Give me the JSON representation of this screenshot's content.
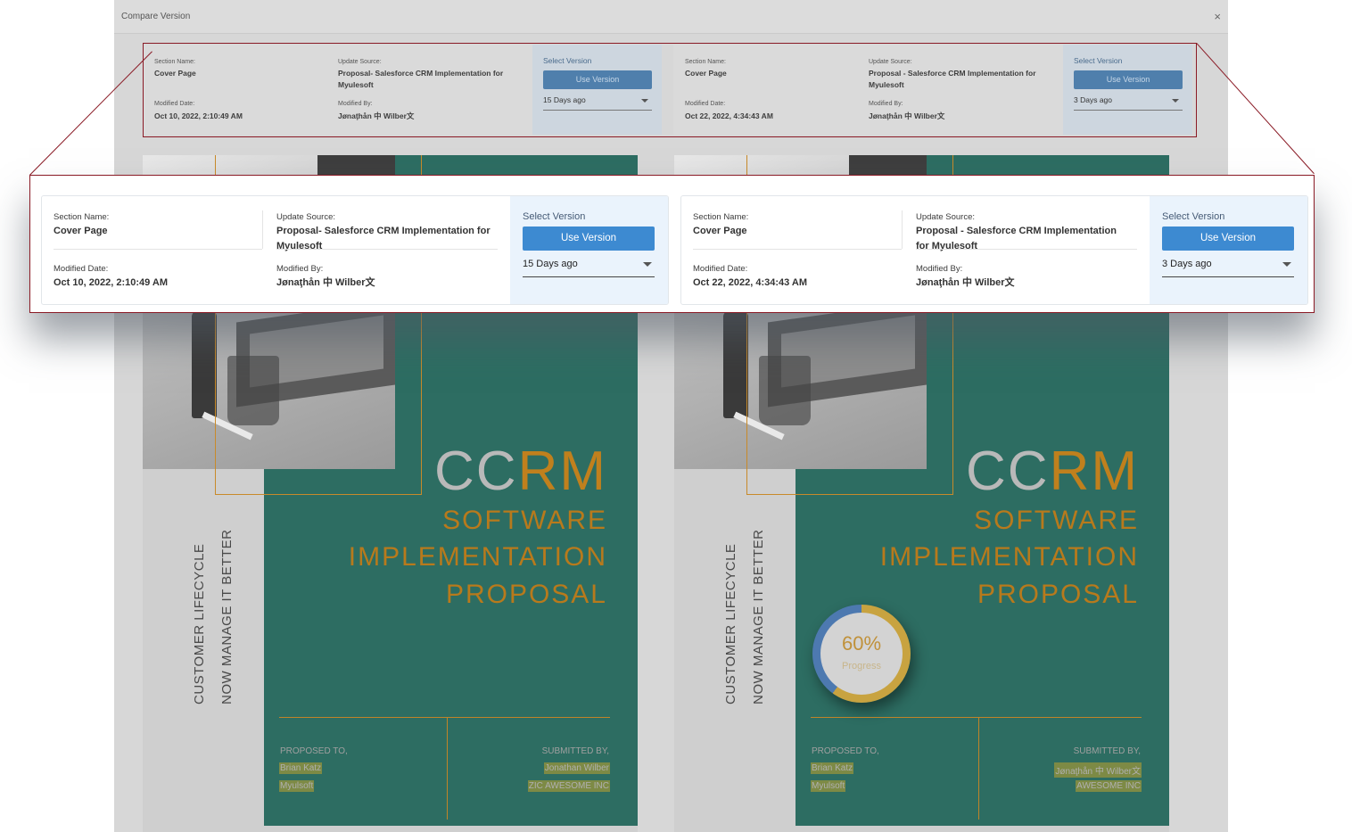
{
  "modal": {
    "title": "Compare Version",
    "close_glyph": "×"
  },
  "versions": [
    {
      "section_name_label": "Section Name:",
      "section_name": "Cover Page",
      "update_source_label": "Update Source:",
      "update_source": "Proposal- Salesforce CRM Implementation for Myulesoft",
      "modified_date_label": "Modified Date:",
      "modified_date": "Oct 10, 2022, 2:10:49 AM",
      "modified_by_label": "Modified By:",
      "modified_by": "Jønaţhån 中 Wilber文",
      "select_version_label": "Select Version",
      "use_version_label": "Use Version",
      "selected_version": "15 Days ago"
    },
    {
      "section_name_label": "Section Name:",
      "section_name": "Cover Page",
      "update_source_label": "Update Source:",
      "update_source": "Proposal - Salesforce CRM Implementation for Myulesoft",
      "modified_date_label": "Modified Date:",
      "modified_date": "Oct 22, 2022, 4:34:43 AM",
      "modified_by_label": "Modified By:",
      "modified_by": "Jønaţhån 中 Wilber文",
      "select_version_label": "Select Version",
      "use_version_label": "Use Version",
      "selected_version": "3 Days ago"
    }
  ],
  "previews": [
    {
      "title_cc": "CC",
      "title_rm": "RM",
      "title_line1": "SOFTWARE",
      "title_line2": "IMPLEMENTATION",
      "title_line3": "PROPOSAL",
      "vertical_1": "CUSTOMER LIFECYCLE",
      "vertical_2": "NOW MANAGE IT BETTER",
      "proposed_to_label": "PROPOSED TO,",
      "proposed_name": "Brian Katz",
      "proposed_company": "Myulsoft",
      "submitted_by_label": "SUBMITTED BY,",
      "submitter_name": "Jonathan Wilber",
      "submitter_company": "ZIC AWESOME INC"
    },
    {
      "title_cc": "CC",
      "title_rm": "RM",
      "title_line1": "SOFTWARE",
      "title_line2": "IMPLEMENTATION",
      "title_line3": "PROPOSAL",
      "vertical_1": "CUSTOMER LIFECYCLE",
      "vertical_2": "NOW MANAGE IT BETTER",
      "progress_value": "60%",
      "progress_label": "Progress",
      "progress_fraction": 0.6,
      "proposed_to_label": "PROPOSED TO,",
      "proposed_name": "Brian Katz",
      "proposed_company": "Myulsoft",
      "submitted_by_label": "SUBMITTED BY,",
      "submitter_name": "Jønaţhån 中 Wilber文",
      "submitter_company": "AWESOME INC"
    }
  ],
  "colors": {
    "accent_blue": "#3d8ad1",
    "teal": "#2d6d62",
    "orange": "#b87a1c",
    "callout_border": "#8a1a25"
  }
}
